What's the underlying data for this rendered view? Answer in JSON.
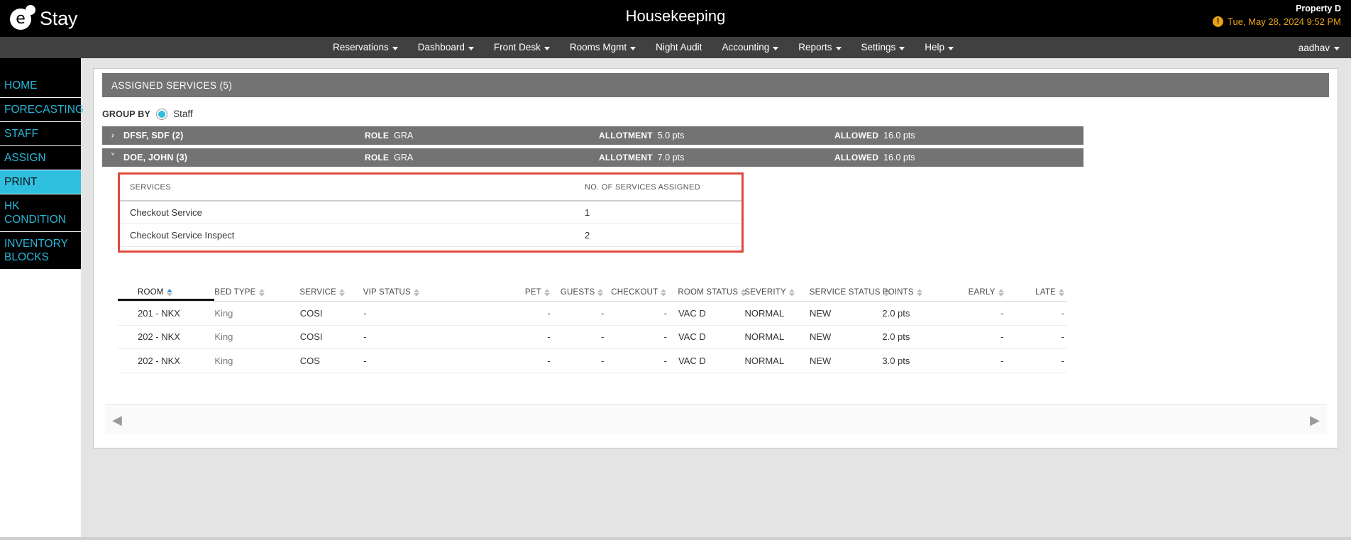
{
  "header": {
    "logo_text": "Stay",
    "logo_letter": "e",
    "page_title": "Housekeeping",
    "property_name": "Property D",
    "datetime": "Tue, May 28, 2024 9:52 PM",
    "warning_icon": "exclamation-icon"
  },
  "nav": {
    "items": [
      {
        "label": "Reservations",
        "has_caret": true
      },
      {
        "label": "Dashboard",
        "has_caret": true
      },
      {
        "label": "Front Desk",
        "has_caret": true
      },
      {
        "label": "Rooms Mgmt",
        "has_caret": true
      },
      {
        "label": "Night Audit",
        "has_caret": false
      },
      {
        "label": "Accounting",
        "has_caret": true
      },
      {
        "label": "Reports",
        "has_caret": true
      },
      {
        "label": "Settings",
        "has_caret": true
      },
      {
        "label": "Help",
        "has_caret": true
      }
    ],
    "user": "aadhav"
  },
  "sidebar": {
    "items": [
      {
        "label": "HOME",
        "active": false
      },
      {
        "label": "FORECASTING",
        "active": false
      },
      {
        "label": "STAFF",
        "active": false
      },
      {
        "label": "ASSIGN",
        "active": false
      },
      {
        "label": "PRINT",
        "active": true
      },
      {
        "label": "HK CONDITION",
        "active": false
      },
      {
        "label": "INVENTORY BLOCKS",
        "active": false
      }
    ]
  },
  "card": {
    "title": "ASSIGNED SERVICES (5)"
  },
  "group_by": {
    "label": "GROUP BY",
    "option": "Staff"
  },
  "groups": [
    {
      "chevron": "chevron-right-icon",
      "name": "DFSF, SDF (2)",
      "role_key": "ROLE",
      "role_value": "GRA",
      "allotment_key": "ALLOTMENT",
      "allotment_value": "5.0 pts",
      "allowed_key": "ALLOWED",
      "allowed_value": "16.0 pts"
    },
    {
      "chevron": "chevron-down-icon",
      "name": "DOE, JOHN (3)",
      "role_key": "ROLE",
      "role_value": "GRA",
      "allotment_key": "ALLOTMENT",
      "allotment_value": "7.0 pts",
      "allowed_key": "ALLOWED",
      "allowed_value": "16.0 pts"
    }
  ],
  "services_table": {
    "headers": [
      "SERVICES",
      "NO. OF SERVICES ASSIGNED"
    ],
    "rows": [
      {
        "service": "Checkout Service",
        "count": "1"
      },
      {
        "service": "Checkout Service Inspect",
        "count": "2"
      }
    ],
    "highlight_color": "#e04a3f"
  },
  "grid": {
    "headers": [
      {
        "label": "ROOM",
        "sorted": true
      },
      {
        "label": "BED TYPE",
        "sorted": false
      },
      {
        "label": "SERVICE",
        "sorted": false
      },
      {
        "label": "VIP STATUS",
        "sorted": false
      },
      {
        "label": "PET",
        "sorted": false
      },
      {
        "label": "GUESTS",
        "sorted": false
      },
      {
        "label": "CHECKOUT",
        "sorted": false
      },
      {
        "label": "ROOM STATUS",
        "sorted": false
      },
      {
        "label": "SEVERITY",
        "sorted": false
      },
      {
        "label": "SERVICE STATUS",
        "sorted": false
      },
      {
        "label": "POINTS",
        "sorted": false
      },
      {
        "label": "EARLY",
        "sorted": false
      },
      {
        "label": "LATE",
        "sorted": false
      }
    ],
    "rows": [
      {
        "room": "201 - NKX",
        "bed_type": "King",
        "service": "COSI",
        "vip_status": "-",
        "pet": "-",
        "guests": "-",
        "checkout": "-",
        "room_status": "VAC D",
        "severity": "NORMAL",
        "service_status": "NEW",
        "points": "2.0 pts",
        "early": "-",
        "late": "-"
      },
      {
        "room": "202 - NKX",
        "bed_type": "King",
        "service": "COSI",
        "vip_status": "-",
        "pet": "-",
        "guests": "-",
        "checkout": "-",
        "room_status": "VAC D",
        "severity": "NORMAL",
        "service_status": "NEW",
        "points": "2.0 pts",
        "early": "-",
        "late": "-"
      },
      {
        "room": "202 - NKX",
        "bed_type": "King",
        "service": "COS",
        "vip_status": "-",
        "pet": "-",
        "guests": "-",
        "checkout": "-",
        "room_status": "VAC D",
        "severity": "NORMAL",
        "service_status": "NEW",
        "points": "3.0 pts",
        "early": "-",
        "late": "-"
      }
    ]
  },
  "scroll": {
    "left_arrow": "◀",
    "right_arrow": "▶"
  },
  "colors": {
    "accent_cyan": "#2fc0e0",
    "warning_orange": "#e8a317",
    "highlight_red": "#e04a3f",
    "header_gray": "#737373"
  }
}
